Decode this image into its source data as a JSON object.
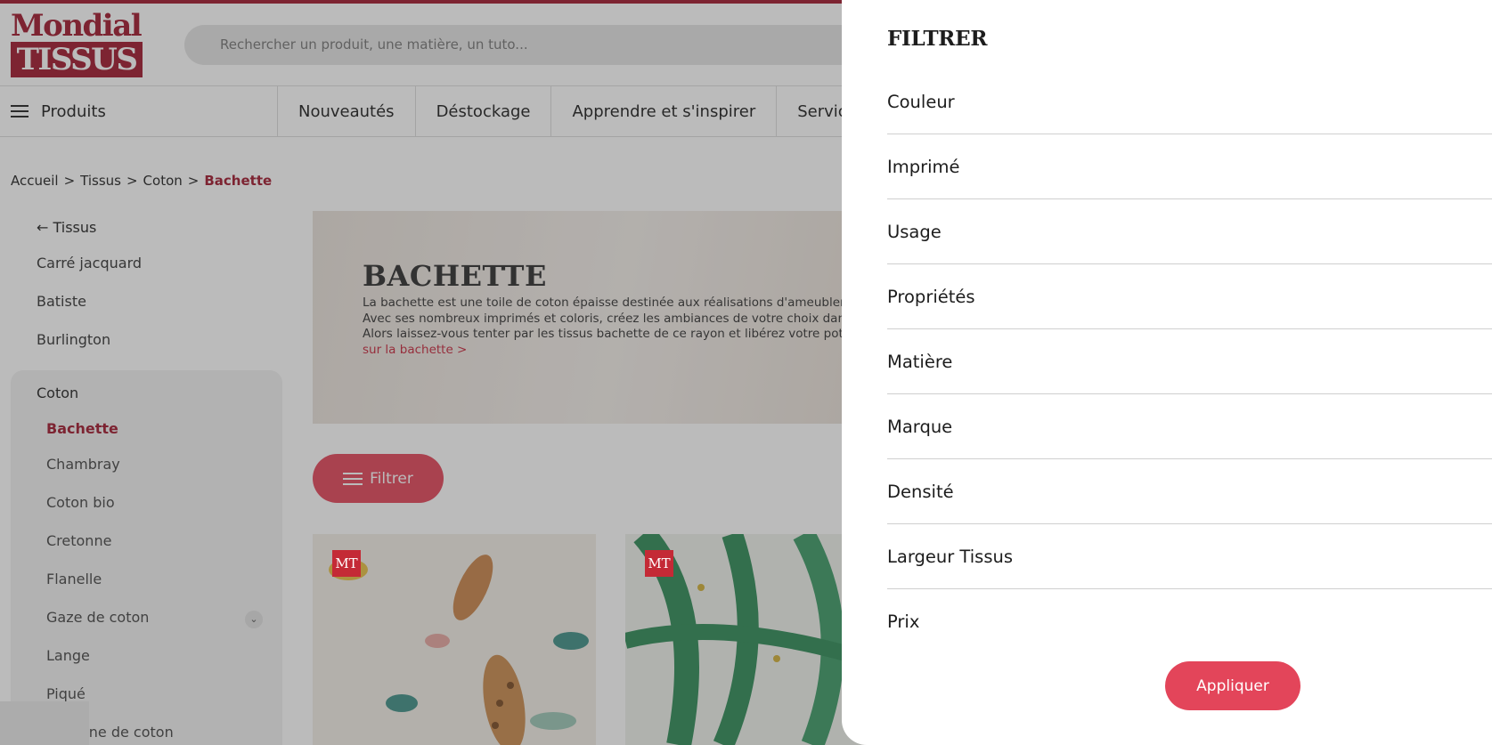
{
  "header": {
    "logo_line1": "Mondial",
    "logo_line2": "TISSUS",
    "search_placeholder": "Rechercher un produit, une matière, un tuto..."
  },
  "nav": {
    "products_label": "Produits",
    "links": [
      "Nouveautés",
      "Déstockage",
      "Apprendre et s'inspirer",
      "Services"
    ]
  },
  "breadcrumb": [
    "Accueil",
    ">",
    "Tissus",
    ">",
    "Coton",
    ">",
    "Bachette"
  ],
  "sidebar": {
    "back_label": "← Tissus",
    "items": [
      "Carré jacquard",
      "Batiste",
      "Burlington"
    ],
    "group_label": "Coton",
    "sub_items": [
      "Bachette",
      "Chambray",
      "Coton bio",
      "Cretonne",
      "Flanelle",
      "Gaze de coton",
      "Lange",
      "Piqué",
      "Popeline de coton"
    ]
  },
  "banner": {
    "title": "BACHETTE",
    "text": "La bachette est une toile de coton épaisse destinée aux réalisations d'ameublement et de décoration. Avec ses nombreux imprimés et coloris, créez les ambiances de votre choix dans chacune de vos pièces. Alors laissez-vous tenter par les tissus bachette de ce rayon et libérez votre potentiel créatif ! ",
    "link": "Tout savoir sur la bachette >"
  },
  "filter_button": "Filtrer",
  "product_badge": "MT",
  "filter_panel": {
    "title": "FILTRER",
    "rows": [
      "Couleur",
      "Imprimé",
      "Usage",
      "Propriétés",
      "Matière",
      "Marque",
      "Densité",
      "Largeur Tissus",
      "Prix"
    ],
    "apply_label": "Appliquer"
  },
  "colors": {
    "brand": "#a0182d",
    "button": "#e3455a"
  }
}
